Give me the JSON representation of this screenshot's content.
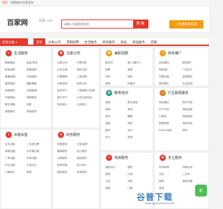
{
  "topbar": {
    "city_label": "首页",
    "links": "切换城市/信息发布"
  },
  "header": {
    "logo_text": "百家网",
    "city": "- 白城 .com"
  },
  "search": {
    "placeholder": "请输入你要搜的信息",
    "button": "搜 索"
  },
  "post_button": "+ 免费发布信息",
  "nav": {
    "category_label": "信息分类 ≡",
    "items": [
      "首页",
      "分类公司",
      "求职招聘",
      "生活服务",
      "商务服务",
      "商品",
      "商品服务",
      "店铺"
    ]
  },
  "cards": [
    {
      "title": "生活服务",
      "color": "#e4392c",
      "icon": "house-icon",
      "items": [
        "搬家搬运",
        "保洁/清洗",
        "家电维修",
        "房屋维修",
        "管道疏通",
        "开锁换锁",
        "婚庆服务",
        "摄影摄像",
        "家政服务",
        "月嫂保姆",
        "开锁修锁",
        "宠物服务",
        "鲜花绿植",
        "回收",
        "宠物服务",
        "其他服务"
      ]
    },
    {
      "title": "注册公司",
      "color": "#e4392c",
      "icon": "building-icon",
      "items": [
        "注册公司",
        "代理记账",
        "公司注销",
        "商标注册",
        "代理报税",
        "工商变更",
        "法律咨询",
        "资质代办",
        "验资开户",
        "一般纳税人申请",
        "银行开户",
        "公司注册地址",
        "年检审计",
        "公司转让"
      ]
    },
    {
      "title": "兼职招聘",
      "color": "#f39c12",
      "icon": "briefcase-icon",
      "items": [
        "服务员",
        "普工/操作工",
        "销售",
        "客服",
        "司机",
        "保安",
        "厨师",
        "快递员",
        "会计",
        "文员",
        "营业员",
        "仓管"
      ]
    },
    {
      "title": "商务推广",
      "color": "#f39c12",
      "icon": "megaphone-icon",
      "items": [
        "网站建设",
        "微信推广",
        "网络推广",
        "广告设计",
        "印刷包装",
        "会展服务",
        "展览展示",
        "礼品定制",
        "标识标牌",
        "其他推广"
      ]
    },
    {
      "title": "教育培训",
      "color": "#2a9d8f",
      "icon": "book-icon",
      "items": [
        "英语",
        "职业技能",
        "家教",
        "美术",
        "音乐",
        "舞蹈",
        "电脑",
        "驾校",
        "留学",
        "会计",
        "设计",
        "其他"
      ]
    },
    {
      "title": "IT互联网服务",
      "color": "#e67e22",
      "icon": "laptop-icon",
      "items": [
        "网站建设",
        "软件开发",
        "APP开发",
        "网络运维",
        "小程序",
        "电脑维修",
        "数据恢复",
        "网络布线",
        "Python培训",
        "其他"
      ]
    },
    {
      "title": "出租出售",
      "color": "#e4392c",
      "icon": "key-icon",
      "items": [
        "住宅出租",
        "二手房出售",
        "商铺出租",
        "写字楼出租",
        "厂房出租",
        "仓库出租",
        "车位出租",
        "土地出让",
        "门面转让",
        "其他"
      ]
    },
    {
      "title": "商务服务",
      "color": "#e4392c",
      "icon": "handshake-icon",
      "items": [
        "快递物流",
        "工程/装修",
        "翻译服务",
        "设计策划",
        "法律服务",
        "保险服务",
        "投资担保",
        "会计审计",
        "保安服务",
        "其他服务"
      ]
    },
    {
      "title": "找房服务",
      "color": "#e4392c",
      "icon": "home-icon",
      "items": [
        "装修设计",
        "建材",
        "家具",
        "灯具",
        "卫浴",
        "涂料",
        "地板",
        "门窗"
      ]
    },
    {
      "title": "本土服务",
      "color": "#e4392c",
      "icon": "pin-icon",
      "items": [
        "本地新闻",
        "同城活动",
        "交友",
        "二手车",
        "维修",
        "招商加盟",
        "其他"
      ]
    }
  ],
  "watermark": {
    "text": "谷普下载",
    "sub": "www.gupuxiazai.com"
  },
  "wechat_icon": "wechat-icon"
}
